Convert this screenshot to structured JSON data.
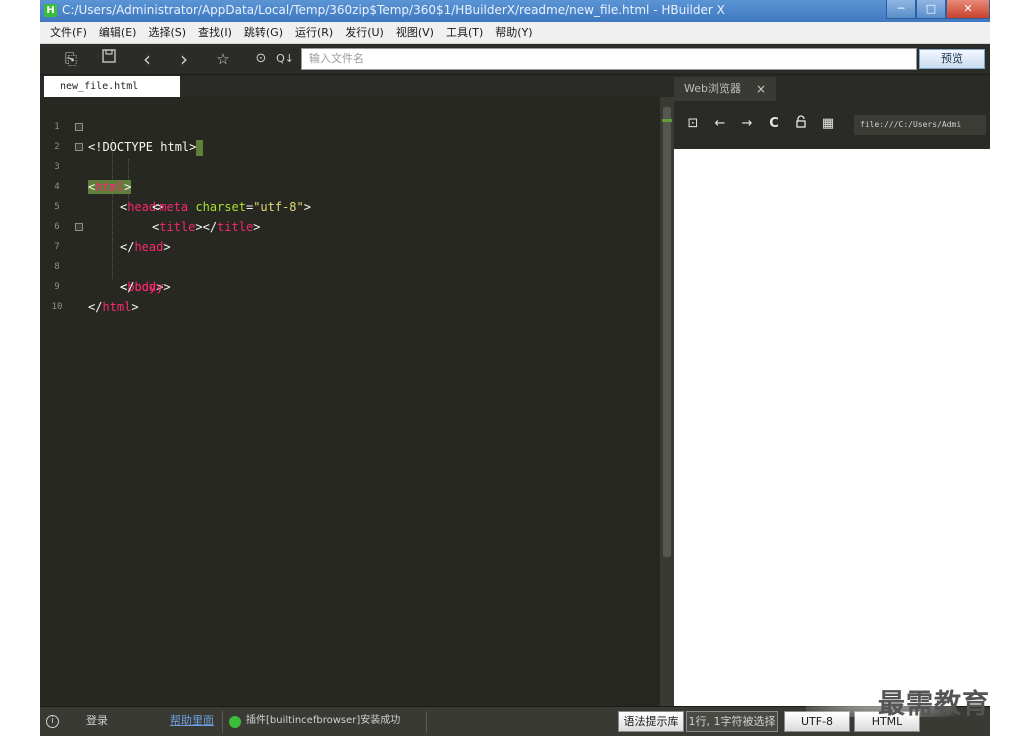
{
  "window": {
    "title": "C:/Users/Administrator/AppData/Local/Temp/360zip$Temp/360$1/HBuilderX/readme/new_file.html - HBuilder X",
    "logo": "H",
    "controls": {
      "minimize": "─",
      "maximize": "□",
      "close": "✕"
    }
  },
  "menu": [
    "文件(F)",
    "编辑(E)",
    "选择(S)",
    "查找(I)",
    "跳转(G)",
    "运行(R)",
    "发行(U)",
    "视图(V)",
    "工具(T)",
    "帮助(Y)"
  ],
  "toolbar": {
    "icons": [
      "new-file-icon",
      "save-icon",
      "back-icon",
      "forward-icon",
      "star-icon",
      "run-icon",
      "search-icon"
    ],
    "glyphs": {
      "new": "⎘",
      "save": "💾",
      "back": "‹",
      "forward": "›",
      "star": "☆",
      "run": "⊙",
      "search": "Q↓"
    },
    "search_placeholder": "输入文件名",
    "preview_label": "预览"
  },
  "editor": {
    "tab_label": "new_file.html",
    "lines": [
      {
        "n": "1"
      },
      {
        "n": "2"
      },
      {
        "n": "3"
      },
      {
        "n": "4"
      },
      {
        "n": "5"
      },
      {
        "n": "6"
      },
      {
        "n": "7"
      },
      {
        "n": "8"
      },
      {
        "n": "9"
      },
      {
        "n": "10"
      }
    ],
    "code": {
      "doctype": "<!DOCTYPE html>",
      "html_open": "html",
      "head": "head",
      "meta": "meta",
      "charset_attr": "charset",
      "charset_val": "\"utf-8\"",
      "title": "title",
      "body": "body",
      "lt": "<",
      "gt": ">",
      "lt_slash": "</",
      "eq": "="
    }
  },
  "browser": {
    "tab_label": "Web浏览器",
    "tab_close": "×",
    "nav": {
      "screen": "⊡",
      "back": "←",
      "forward": "→",
      "reload": "C",
      "lock": "🔓",
      "qr": "▦"
    },
    "url": "file:///C:/Users/Admi"
  },
  "status": {
    "info_glyph": "i",
    "login": "登录",
    "help_link": "帮助里面",
    "plugin_message": "插件[builtincefbrowser]安装成功",
    "syntax_button": "语法提示库",
    "cursor_pos": "1行, 1字符被选择",
    "encoding": "UTF-8",
    "language": "HTML"
  },
  "watermark": "最需教育"
}
